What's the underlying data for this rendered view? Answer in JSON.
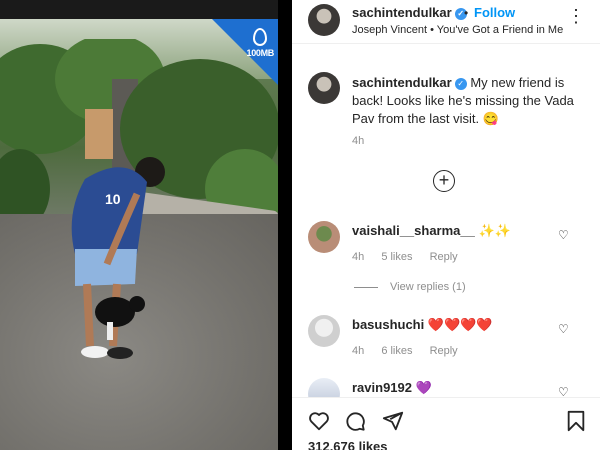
{
  "post": {
    "username": "sachintendulkar",
    "follow_label": "Follow",
    "dot": "•",
    "music": "Joseph Vincent • You've Got a Friend in Me",
    "caption": "My new friend is back! Looks like he's missing the Vada Pav from the last visit. 😋",
    "caption_time": "4h",
    "brand_label": "100MB",
    "likes": "312,676 likes"
  },
  "comments": [
    {
      "username": "vaishali__sharma__ ✨✨",
      "time": "4h",
      "likes": "5 likes",
      "reply": "Reply"
    },
    {
      "username": "basushuchi ❤️❤️❤️❤️",
      "time": "4h",
      "likes": "6 likes",
      "reply": "Reply"
    },
    {
      "username": "ravin9192 💜"
    }
  ],
  "view_replies": "View replies (1)",
  "icons": {
    "more": "more-options-icon",
    "verified": "verified-icon",
    "load_more": "plus-circle-icon",
    "like": "heart-icon",
    "comment": "comment-icon",
    "share": "send-icon",
    "save": "bookmark-icon"
  },
  "colors": {
    "follow": "#0095f6",
    "verified": "#3897f0",
    "brand": "#1e6fd0"
  }
}
